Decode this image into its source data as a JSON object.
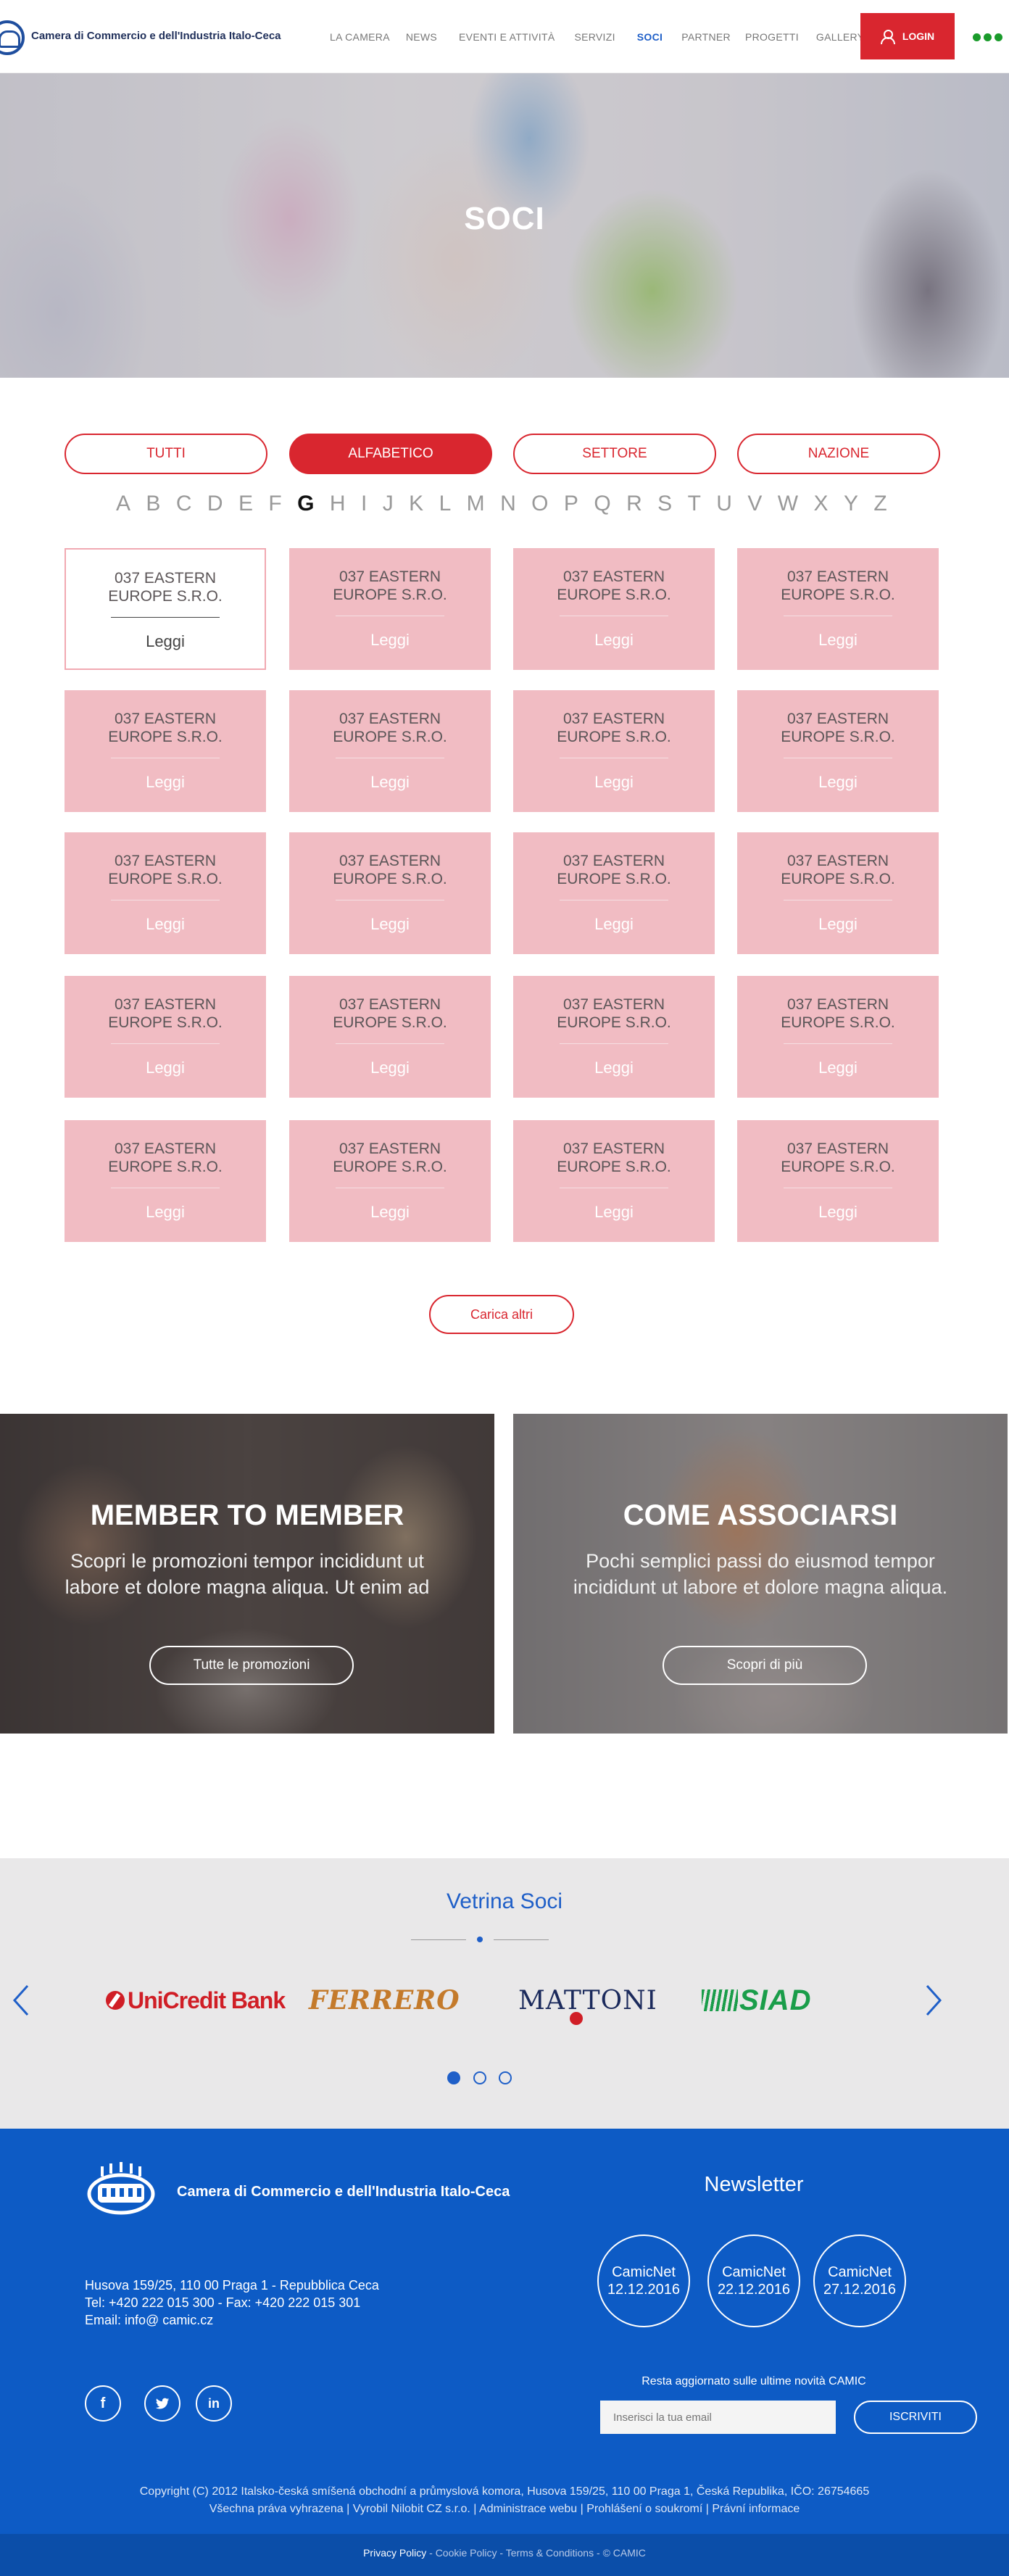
{
  "header": {
    "brand": "Camera di Commercio e dell'Industria Italo-Ceca",
    "nav": [
      {
        "label": "LA CAMERA",
        "active": false
      },
      {
        "label": "NEWS",
        "active": false
      },
      {
        "label": "EVENTI E ATTIVITÀ",
        "active": false
      },
      {
        "label": "SERVIZI",
        "active": false
      },
      {
        "label": "SOCI",
        "active": true
      },
      {
        "label": "PARTNER",
        "active": false
      },
      {
        "label": "PROGETTI",
        "active": false
      },
      {
        "label": "GALLERY",
        "active": false
      }
    ],
    "login_label": "LOGIN"
  },
  "hero": {
    "title": "SOCI"
  },
  "filters": [
    {
      "label": "TUTTI",
      "active": false
    },
    {
      "label": "ALFABETICO",
      "active": true
    },
    {
      "label": "SETTORE",
      "active": false
    },
    {
      "label": "NAZIONE",
      "active": false
    }
  ],
  "alphabet": {
    "letters": [
      "A",
      "B",
      "C",
      "D",
      "E",
      "F",
      "G",
      "H",
      "I",
      "J",
      "K",
      "L",
      "M",
      "N",
      "O",
      "P",
      "Q",
      "R",
      "S",
      "T",
      "U",
      "V",
      "W",
      "X",
      "Y",
      "Z"
    ],
    "active": "G"
  },
  "members": {
    "items": [
      {
        "name": "037 EASTERN EUROPE S.R.O.",
        "link": "Leggi"
      },
      {
        "name": "037 EASTERN EUROPE S.R.O.",
        "link": "Leggi"
      },
      {
        "name": "037 EASTERN EUROPE S.R.O.",
        "link": "Leggi"
      },
      {
        "name": "037 EASTERN EUROPE S.R.O.",
        "link": "Leggi"
      },
      {
        "name": "037 EASTERN EUROPE S.R.O.",
        "link": "Leggi"
      },
      {
        "name": "037 EASTERN EUROPE S.R.O.",
        "link": "Leggi"
      },
      {
        "name": "037 EASTERN EUROPE S.R.O.",
        "link": "Leggi"
      },
      {
        "name": "037 EASTERN EUROPE S.R.O.",
        "link": "Leggi"
      },
      {
        "name": "037 EASTERN EUROPE S.R.O.",
        "link": "Leggi"
      },
      {
        "name": "037 EASTERN EUROPE S.R.O.",
        "link": "Leggi"
      },
      {
        "name": "037 EASTERN EUROPE S.R.O.",
        "link": "Leggi"
      },
      {
        "name": "037 EASTERN EUROPE S.R.O.",
        "link": "Leggi"
      },
      {
        "name": "037 EASTERN EUROPE S.R.O.",
        "link": "Leggi"
      },
      {
        "name": "037 EASTERN EUROPE S.R.O.",
        "link": "Leggi"
      },
      {
        "name": "037 EASTERN EUROPE S.R.O.",
        "link": "Leggi"
      },
      {
        "name": "037 EASTERN EUROPE S.R.O.",
        "link": "Leggi"
      },
      {
        "name": "037 EASTERN EUROPE S.R.O.",
        "link": "Leggi"
      },
      {
        "name": "037 EASTERN EUROPE S.R.O.",
        "link": "Leggi"
      },
      {
        "name": "037 EASTERN EUROPE S.R.O.",
        "link": "Leggi"
      },
      {
        "name": "037 EASTERN EUROPE S.R.O.",
        "link": "Leggi"
      }
    ],
    "load_more": "Carica altri"
  },
  "promos": [
    {
      "title": "MEMBER TO MEMBER",
      "text": "Scopri le promozioni tempor incididunt ut labore et dolore magna aliqua. Ut enim ad",
      "button": "Tutte le promozioni"
    },
    {
      "title": "COME ASSOCIARSI",
      "text": "Pochi semplici passi do eiusmod tempor incididunt ut labore et dolore magna aliqua.",
      "button": "Scopri di più"
    }
  ],
  "vetrina": {
    "title": "Vetrina Soci",
    "brands": [
      "UniCredit Bank",
      "FERRERO",
      "MATTONI",
      "SIAD"
    ],
    "pager": {
      "pages": 3,
      "current": 1
    }
  },
  "footer": {
    "name": "Camera di Commercio e dell'Industria Italo-Ceca",
    "address": "Husova 159/25, 110 00 Praga 1 - Repubblica Ceca",
    "phone": "Tel: +420 222 015 300 - Fax: +420 222 015 301",
    "email": "Email: info@ camic.cz",
    "social": [
      "f",
      "t",
      "in"
    ],
    "newsletter_title": "Newsletter",
    "camicnet": [
      {
        "label": "CamicNet",
        "date": "12.12.2016"
      },
      {
        "label": "CamicNet",
        "date": "22.12.2016"
      },
      {
        "label": "CamicNet",
        "date": "27.12.2016"
      }
    ],
    "newsletter_sub": "Resta aggiornato sulle ultime novità CAMIC",
    "email_placeholder": "Inserisci la tua email",
    "subscribe": "ISCRIVITI",
    "copyright_1": "Copyright (C) 2012 Italsko-česká smíšená obchodní a průmyslová komora, Husova 159/25, 110 00 Praga 1, Česká Republika, IČO: 26754665",
    "copyright_2": "Všechna práva vyhrazena | Vyrobil Nilobit CZ s.r.o. | Administrace webu | Prohlášení o soukromí | Právní informace",
    "bottom_links": [
      "Privacy Policy",
      "Cookie Policy",
      "Terms & Conditions",
      "© CAMIC"
    ]
  },
  "colors": {
    "accent": "#d9262f",
    "blue": "#0d5bc5",
    "card": "#f1bcc3"
  }
}
